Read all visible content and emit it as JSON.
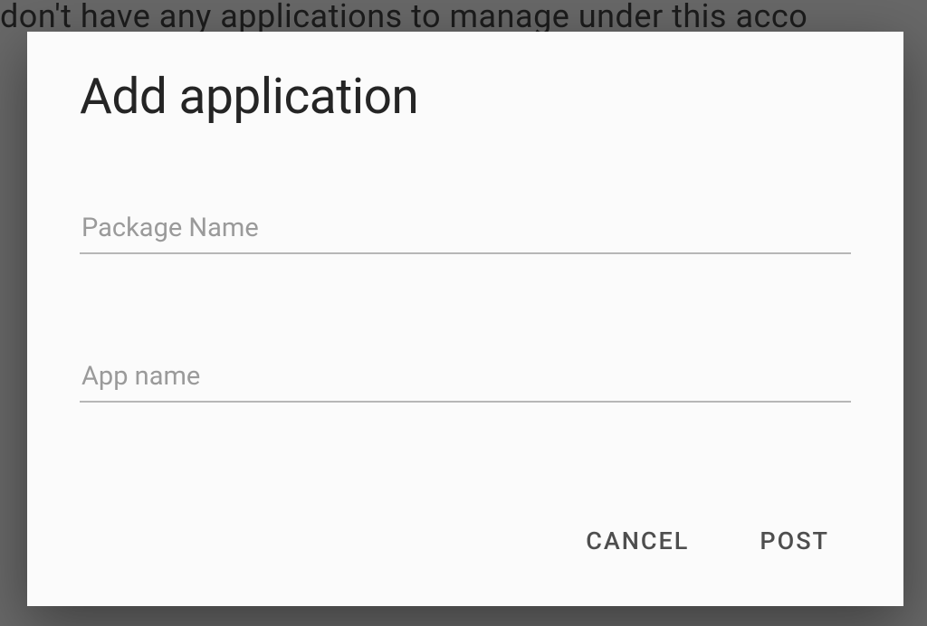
{
  "background": {
    "partial_text": "don't have any applications to manage under this acco"
  },
  "dialog": {
    "title": "Add application",
    "fields": {
      "package_name": {
        "placeholder": "Package Name",
        "value": ""
      },
      "app_name": {
        "placeholder": "App name",
        "value": ""
      }
    },
    "actions": {
      "cancel_label": "CANCEL",
      "post_label": "POST"
    }
  }
}
